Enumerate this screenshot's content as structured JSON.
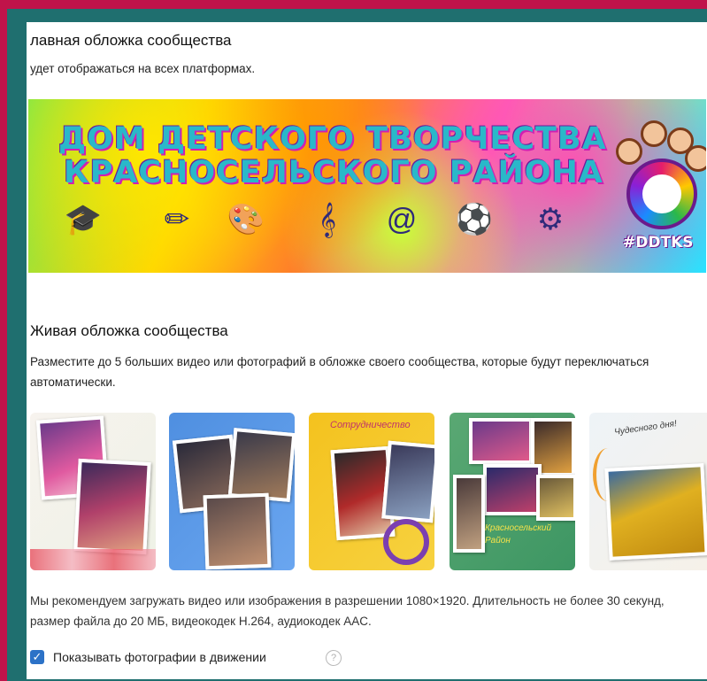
{
  "main_cover": {
    "title": "лавная обложка сообщества",
    "subtitle": "удет отображаться на всех платформах.",
    "banner": {
      "line1": "ДОМ ДЕТСКОГО ТВОРЧЕСТВА",
      "line2": "КРАСНОСЕЛЬСКОГО РАЙОНА",
      "hashtag": "#DDTKS",
      "icons": [
        "graduation-cap-icon",
        "pencil-icon",
        "palette-icon",
        "treble-clef-icon",
        "at-sign-icon",
        "soccer-ball-icon",
        "gear-icon"
      ]
    }
  },
  "live_cover": {
    "title": "Живая обложка сообщества",
    "description": "Разместите до 5 больших видео или фотографий в обложке своего сообщества, которые будут переключаться автоматически.",
    "thumbnails": [
      {
        "caption": ""
      },
      {
        "caption": ""
      },
      {
        "caption": "Сотрудничество"
      },
      {
        "caption": "Красносельский Район"
      },
      {
        "caption": "Чудесного дня!"
      }
    ],
    "recommendation": "Мы рекомендуем загружать видео или изображения в разрешении 1080×1920. Длительность не более 30 секунд, размер файла до 20 МБ, видеокодек H.264, аудиокодек AAC.",
    "checkbox": {
      "label": "Показывать фотографии в движении",
      "checked": true
    },
    "help_symbol": "?"
  }
}
